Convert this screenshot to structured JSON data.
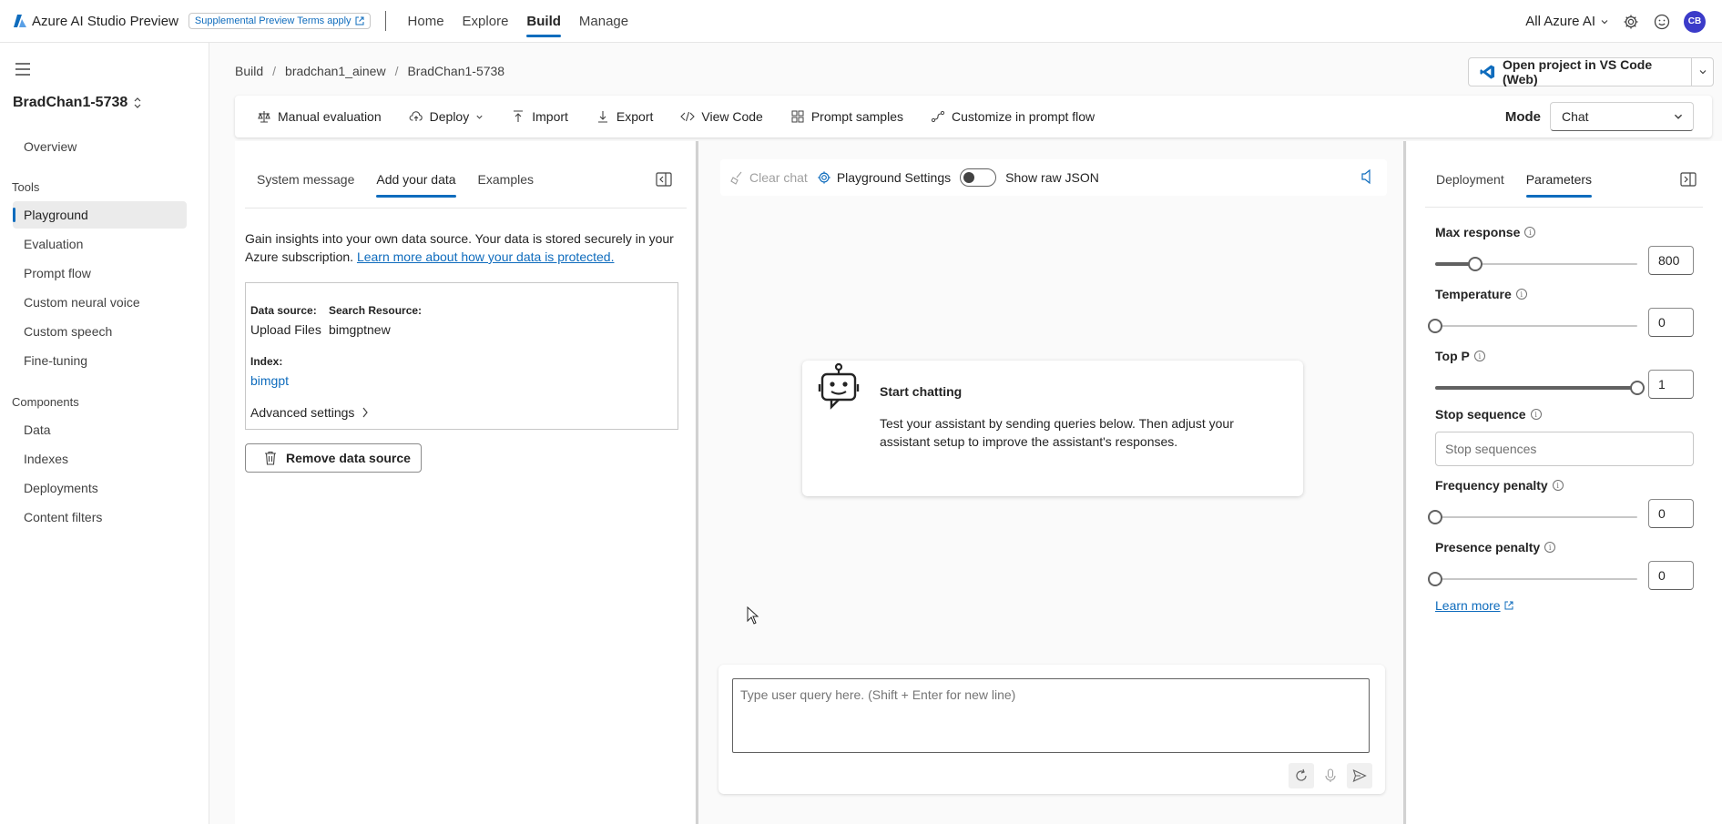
{
  "topbar": {
    "brand": "Azure AI Studio Preview",
    "terms_badge": "Supplemental Preview Terms apply",
    "nav": [
      "Home",
      "Explore",
      "Build",
      "Manage"
    ],
    "active_nav": "Build",
    "scope": "All Azure AI",
    "avatar_initials": "CB"
  },
  "sidebar": {
    "project": "BradChan1-5738",
    "overview": "Overview",
    "tools_heading": "Tools",
    "tools": [
      "Playground",
      "Evaluation",
      "Prompt flow",
      "Custom neural voice",
      "Custom speech",
      "Fine-tuning"
    ],
    "components_heading": "Components",
    "components": [
      "Data",
      "Indexes",
      "Deployments",
      "Content filters"
    ],
    "active": "Playground"
  },
  "breadcrumb": [
    "Build",
    "bradchan1_ainew",
    "BradChan1-5738"
  ],
  "vscode_button": "Open project in VS Code (Web)",
  "toolbar": {
    "manual_eval": "Manual evaluation",
    "deploy": "Deploy",
    "import": "Import",
    "export": "Export",
    "view_code": "View Code",
    "prompt_samples": "Prompt samples",
    "customize": "Customize in prompt flow",
    "mode_label": "Mode",
    "mode_value": "Chat"
  },
  "left_panel": {
    "tabs": [
      "System message",
      "Add your data",
      "Examples"
    ],
    "active_tab": "Add your data",
    "intro": "Gain insights into your own data source. Your data is stored securely in your Azure subscription.",
    "intro_link": "Learn more about how your data is protected.",
    "data_source_label": "Data source:",
    "data_source_value": "Upload Files",
    "search_resource_label": "Search Resource:",
    "search_resource_value": "bimgptnew",
    "index_label": "Index:",
    "index_value": "bimgpt",
    "advanced": "Advanced settings",
    "remove_button": "Remove data source"
  },
  "chat": {
    "clear": "Clear chat",
    "settings": "Playground Settings",
    "raw_json": "Show raw JSON",
    "start_title": "Start chatting",
    "start_text": "Test your assistant by sending queries below. Then adjust your assistant setup to improve the assistant's responses.",
    "input_placeholder": "Type user query here. (Shift + Enter for new line)"
  },
  "right_panel": {
    "tabs": [
      "Deployment",
      "Parameters"
    ],
    "active_tab": "Parameters",
    "max_response_label": "Max response",
    "max_response_value": "800",
    "max_response_fraction": 0.2,
    "temperature_label": "Temperature",
    "temperature_value": "0",
    "temperature_fraction": 0,
    "top_p_label": "Top P",
    "top_p_value": "1",
    "top_p_fraction": 1,
    "stop_label": "Stop sequence",
    "stop_placeholder": "Stop sequences",
    "freq_label": "Frequency penalty",
    "freq_value": "0",
    "freq_fraction": 0,
    "presence_label": "Presence penalty",
    "presence_value": "0",
    "presence_fraction": 0,
    "learn_more": "Learn more"
  },
  "colors": {
    "accent": "#0f6cbd",
    "avatar": "#3b3bc9"
  }
}
